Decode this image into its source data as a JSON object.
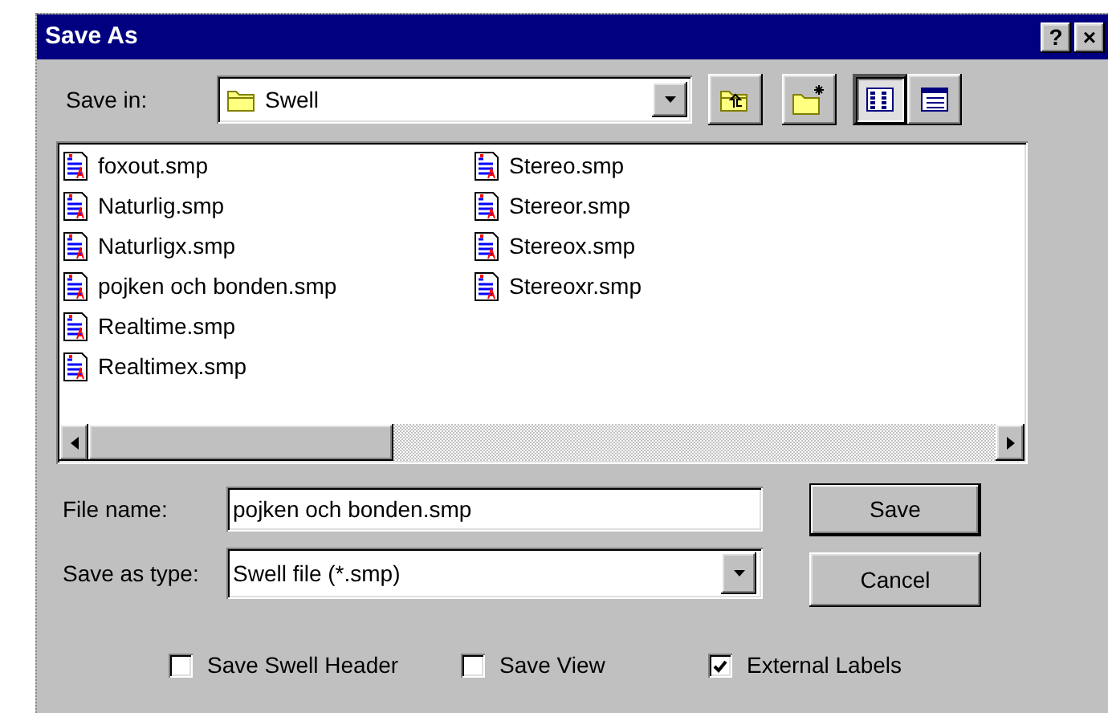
{
  "window": {
    "title": "Save As",
    "title_buttons": [
      {
        "kind": "help",
        "label": "?"
      },
      {
        "kind": "close",
        "label": "×"
      }
    ]
  },
  "save_in": {
    "label": "Save in:",
    "value": "Swell"
  },
  "views": [
    {
      "kind": "list",
      "selected": true
    },
    {
      "kind": "details",
      "selected": false
    }
  ],
  "files": [
    "foxout.smp",
    "Naturlig.smp",
    "Naturligx.smp",
    "pojken och bonden.smp",
    "Realtime.smp",
    "Realtimex.smp",
    "Stereo.smp",
    "Stereor.smp",
    "Stereox.smp",
    "Stereoxr.smp"
  ],
  "file_name": {
    "label": "File name:",
    "value": "pojken och bonden.smp"
  },
  "save_as_type": {
    "label": "Save as type:",
    "value": "Swell file (*.smp)"
  },
  "buttons": [
    {
      "label": "Save",
      "default": true
    },
    {
      "label": "Cancel",
      "default": false
    }
  ],
  "options": [
    {
      "label": "Save Swell Header",
      "checked": false
    },
    {
      "label": "Save View",
      "checked": false
    },
    {
      "label": "External Labels",
      "checked": true
    }
  ]
}
